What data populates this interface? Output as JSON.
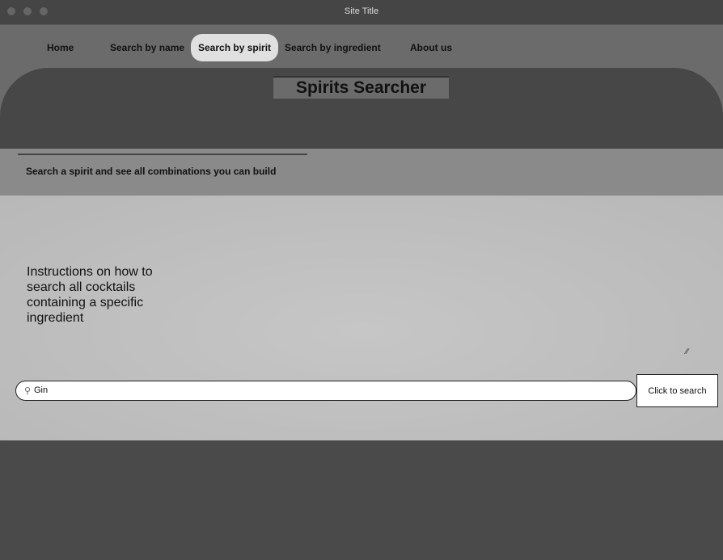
{
  "window": {
    "title": "Site Title"
  },
  "nav": {
    "items": [
      {
        "label": "Home",
        "active": false
      },
      {
        "label": "Search by name",
        "active": false
      },
      {
        "label": "Search by spirit",
        "active": true
      },
      {
        "label": "Search by ingredient",
        "active": false
      },
      {
        "label": "About us",
        "active": false
      }
    ]
  },
  "header": {
    "title": "Spirits Searcher"
  },
  "subheader": {
    "text": "Search a spirit and see all combinations you can build"
  },
  "main": {
    "instructions": "Instructions on how to search all cocktails containing a specific ingredient",
    "search_value": "Gin",
    "search_button": "Click to search"
  }
}
